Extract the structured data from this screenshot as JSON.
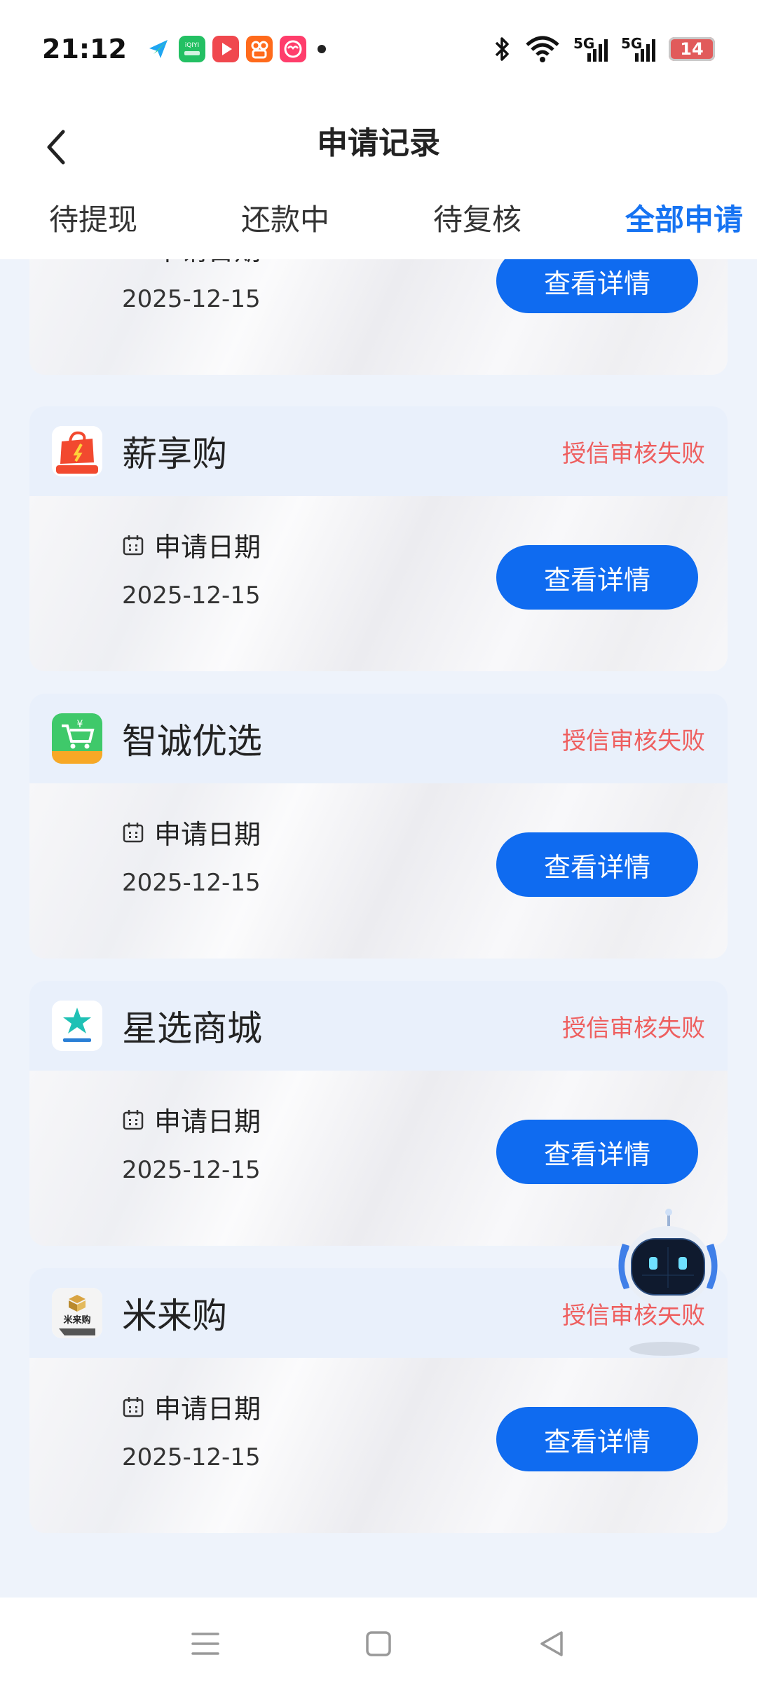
{
  "status_bar": {
    "time": "21:12",
    "app_icons": [
      "feishu-icon",
      "iqiyi-icon",
      "video-icon",
      "kuaishou-icon",
      "shopping-icon"
    ],
    "signal_label_1": "5G",
    "signal_label_2": "5G",
    "battery": "14"
  },
  "header": {
    "title": "申请记录",
    "tabs": [
      "待提现",
      "还款中",
      "待复核",
      "全部申请"
    ],
    "active_tab": "全部申请"
  },
  "cards": [
    {
      "name": "",
      "status": "",
      "date_label": "申请日期",
      "date": "2025-12-15",
      "button": "查看详情"
    },
    {
      "name": "薪享购",
      "logo_text": "薪享购",
      "status": "授信审核失败",
      "date_label": "申请日期",
      "date": "2025-12-15",
      "button": "查看详情"
    },
    {
      "name": "智诚优选",
      "logo_text": "智诚优选",
      "status": "授信审核失败",
      "date_label": "申请日期",
      "date": "2025-12-15",
      "button": "查看详情"
    },
    {
      "name": "星选商城",
      "logo_text": "星选商城",
      "status": "授信审核失败",
      "date_label": "申请日期",
      "date": "2025-12-15",
      "button": "查看详情"
    },
    {
      "name": "米来购",
      "logo_text": "米来购",
      "status": "授信审核失败",
      "date_label": "申请日期",
      "date": "2025-12-15",
      "button": "查看详情"
    }
  ],
  "colors": {
    "accent": "#1673f2",
    "button": "#0f6bf0",
    "fail_status": "#ee5f5f",
    "page_bg": "#eef3fb"
  }
}
